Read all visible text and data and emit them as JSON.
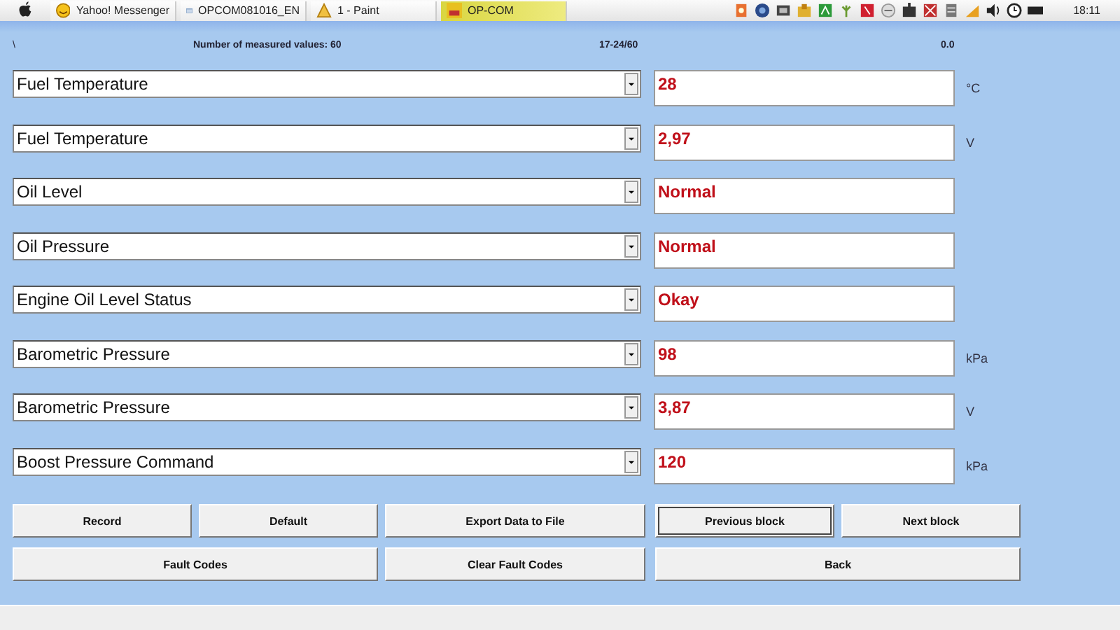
{
  "taskbar": {
    "tasks": [
      {
        "label": "Yahoo! Messenger",
        "selected": false
      },
      {
        "label": "OPCOM081016_EN",
        "selected": false
      },
      {
        "label": "1 - Paint",
        "selected": false
      },
      {
        "label": "OP-COM",
        "selected": true
      }
    ],
    "clock": "18:11"
  },
  "header": {
    "path": "\\",
    "count_label": "Number of measured values: 60",
    "range": "17-24/60",
    "value": "0.0"
  },
  "measurements": [
    {
      "name": "Fuel Temperature",
      "value": "28",
      "unit": "°C"
    },
    {
      "name": "Fuel Temperature",
      "value": "2,97",
      "unit": "V"
    },
    {
      "name": "Oil Level",
      "value": "Normal"
    },
    {
      "name": "Oil Pressure",
      "value": "Normal"
    },
    {
      "name": "Engine Oil Level Status",
      "value": "Okay"
    },
    {
      "name": "Barometric Pressure",
      "value": "98",
      "unit": "kPa"
    },
    {
      "name": "Barometric Pressure",
      "value": "3,87",
      "unit": "V"
    },
    {
      "name": "Boost Pressure Command",
      "value": "120",
      "unit": "kPa"
    }
  ],
  "button_rows": [
    [
      {
        "label": "Record",
        "focused": false
      },
      {
        "label": "Default",
        "focused": false
      },
      {
        "label": "Export Data to File",
        "focused": false
      },
      {
        "label": "Previous block",
        "focused": true
      },
      {
        "label": "Next block",
        "focused": false
      }
    ],
    [
      {
        "label": "Fault Codes",
        "focused": false
      },
      {
        "label": "Clear Fault Codes",
        "focused": false
      },
      {
        "label": "Back",
        "focused": false
      }
    ]
  ]
}
